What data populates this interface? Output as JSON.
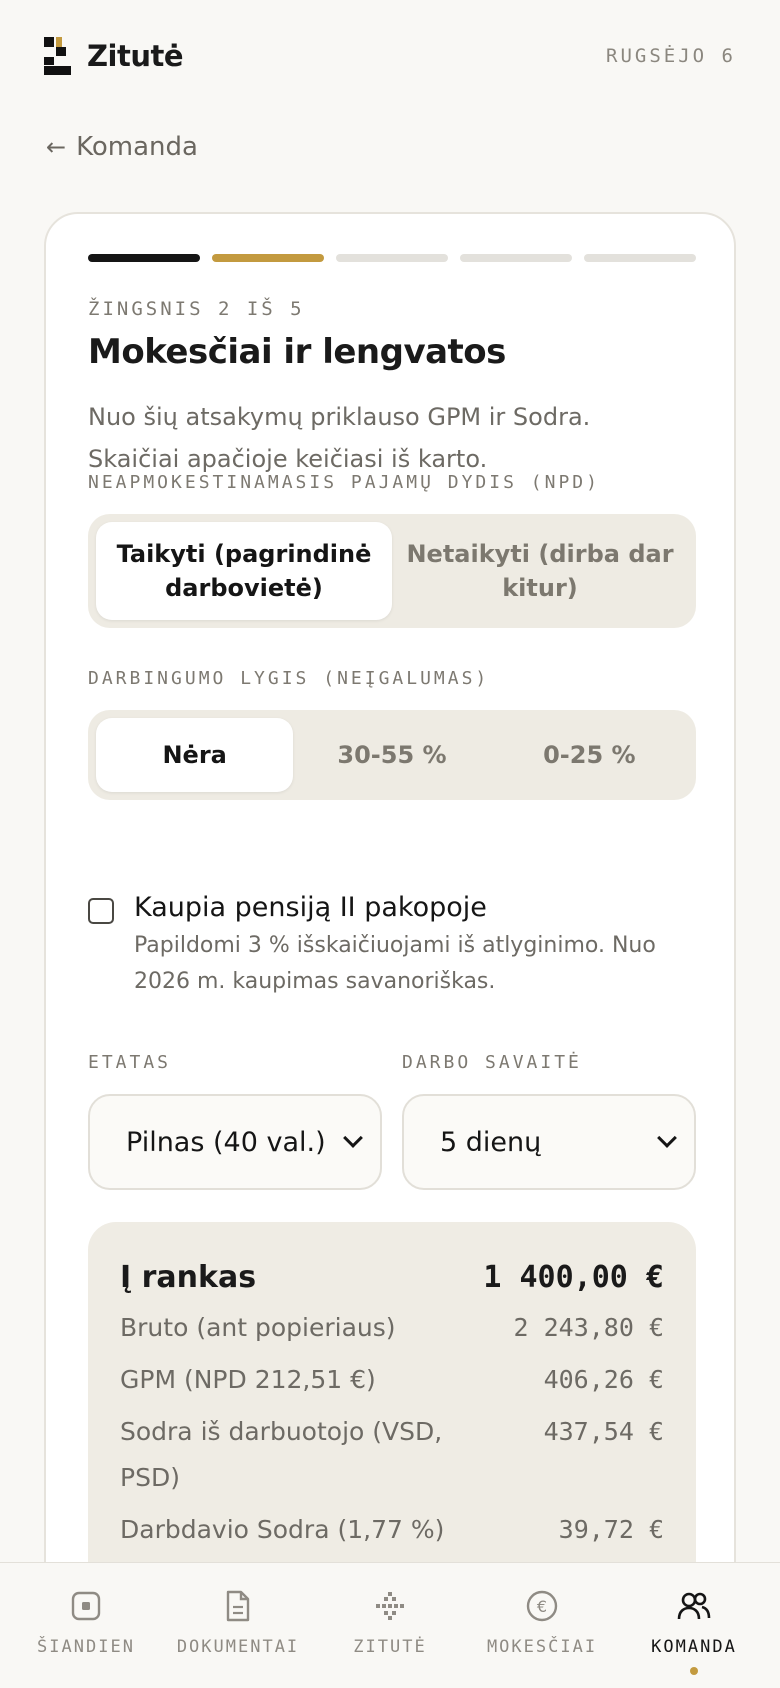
{
  "header": {
    "brand": "Zitutė",
    "date": "RUGSĖJO 6"
  },
  "back": {
    "arrow": "←",
    "label": "Komanda"
  },
  "wizard": {
    "step_label": "ŽINGSNIS 2 IŠ 5",
    "current_step": 2,
    "total_steps": 5,
    "title": "Mokesčiai ir lengvatos",
    "description": "Nuo šių atsakymų priklauso GPM ir Sodra. Skaičiai apačioje keičiasi iš karto."
  },
  "npd": {
    "label": "NEAPMOKESTINAMASIS PAJAMŲ DYDIS (NPD)",
    "options": [
      "Taikyti (pagrindinė darbovietė)",
      "Netaikyti (dirba dar kitur)"
    ],
    "selected": "Taikyti (pagrindinė darbovietė)"
  },
  "disability": {
    "label": "DARBINGUMO LYGIS (NEĮGALUMAS)",
    "options": [
      "Nėra",
      "30-55 %",
      "0-25 %"
    ],
    "selected": "Nėra"
  },
  "pension": {
    "checked": false,
    "title": "Kaupia pensiją II pakopoje",
    "note": "Papildomi 3 % išskaičiuojami iš atlyginimo. Nuo 2026 m. kaupimas savanoriškas."
  },
  "etatas": {
    "label": "ETATAS",
    "value": "Pilnas (40 val.)"
  },
  "work_week": {
    "label": "DARBO SAVAITĖ",
    "value": "5 dienų"
  },
  "summary": {
    "main_label": "Į rankas",
    "main_value": "1 400,00 €",
    "rows": [
      {
        "label": "Bruto (ant popieriaus)",
        "value": "2 243,80 €"
      },
      {
        "label": "GPM (NPD 212,51 €)",
        "value": "406,26 €"
      },
      {
        "label": "Sodra iš darbuotojo (VSD, PSD)",
        "value": "437,54 €"
      },
      {
        "label": "Darbdavio Sodra (1,77 %)",
        "value": "39,72 €"
      }
    ]
  },
  "nav": {
    "items": [
      {
        "label": "ŠIANDIEN",
        "icon": "today-icon"
      },
      {
        "label": "DOKUMENTAI",
        "icon": "document-icon"
      },
      {
        "label": "ZITUTĖ",
        "icon": "sparkle-icon"
      },
      {
        "label": "MOKESČIAI",
        "icon": "euro-icon"
      },
      {
        "label": "KOMANDA",
        "icon": "team-icon"
      }
    ],
    "active": "KOMANDA"
  },
  "colors": {
    "accent": "#c39a3f",
    "background": "#f9f8f5",
    "panel": "#efece4",
    "text": "#151515",
    "muted": "#6d6a64"
  }
}
